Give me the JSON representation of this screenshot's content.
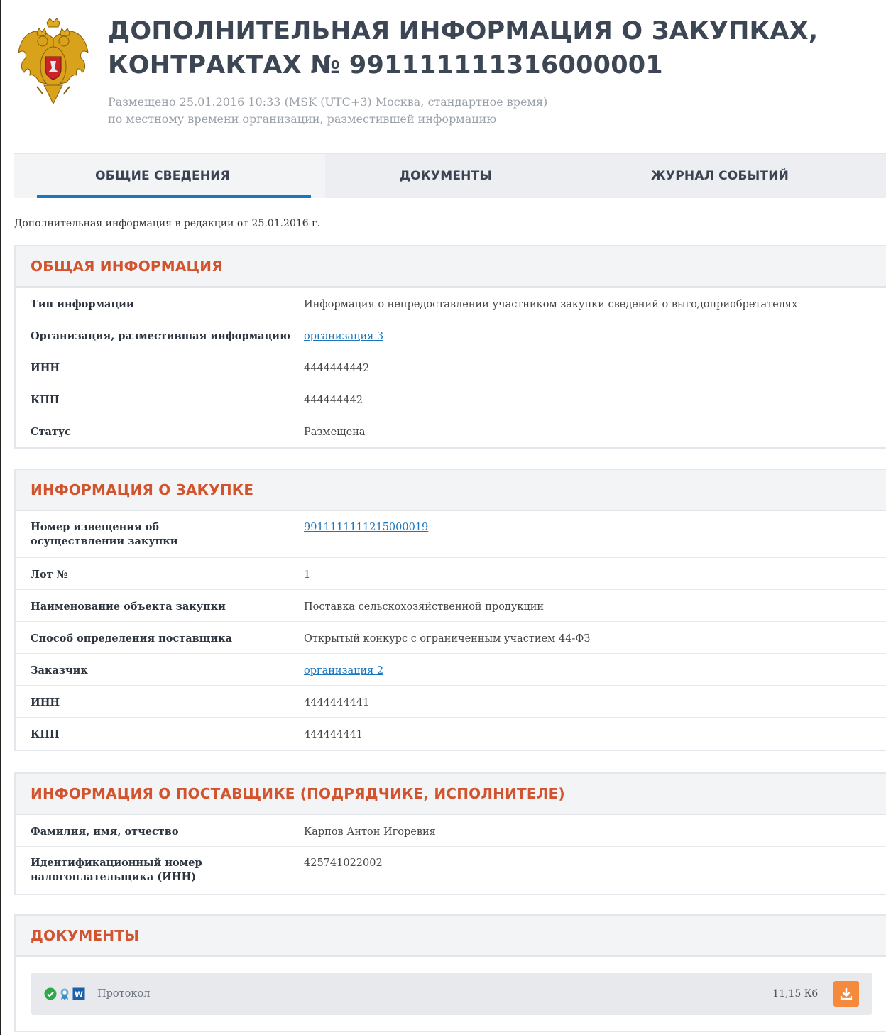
{
  "header": {
    "title": "ДОПОЛНИТЕЛЬНАЯ ИНФОРМАЦИЯ О ЗАКУПКАХ, КОНТРАКТАХ № 991111111316000001",
    "subtitle_line1": "Размещено 25.01.2016 10:33 (MSK (UTC+3) Москва, стандартное время)",
    "subtitle_line2": "по местному времени организации, разместившей информацию"
  },
  "tabs": [
    {
      "label": "ОБЩИЕ СВЕДЕНИЯ",
      "active": true
    },
    {
      "label": "ДОКУМЕНТЫ",
      "active": false
    },
    {
      "label": "ЖУРНАЛ СОБЫТИЙ",
      "active": false
    }
  ],
  "edition_text": "Дополнительная информация в редакции от 25.01.2016 г.",
  "general": {
    "title": "ОБЩАЯ ИНФОРМАЦИЯ",
    "rows": [
      {
        "label": "Тип информации",
        "value": "Информация о непредоставлении участником закупки сведений о выгодоприобретателях"
      },
      {
        "label": "Организация, разместившая информацию",
        "value": "организация 3"
      },
      {
        "label": "ИНН",
        "value": "4444444442"
      },
      {
        "label": "КПП",
        "value": "444444442"
      },
      {
        "label": "Статус",
        "value": "Размещена"
      }
    ]
  },
  "purchase": {
    "title": "ИНФОРМАЦИЯ О ЗАКУПКЕ",
    "rows": [
      {
        "label": "Номер извещения об осуществлении закупки",
        "value": "9911111111215000019"
      },
      {
        "label": "Лот №",
        "value": "1"
      },
      {
        "label": "Наименование объекта закупки",
        "value": "Поставка сельскохозяйственной продукции"
      },
      {
        "label": "Способ определения поставщика",
        "value": "Открытый конкурс с ограниченным участием 44-ФЗ"
      },
      {
        "label": "Заказчик",
        "value": "организация 2"
      },
      {
        "label": "ИНН",
        "value": "4444444441"
      },
      {
        "label": "КПП",
        "value": "444444441"
      }
    ]
  },
  "supplier": {
    "title": "ИНФОРМАЦИЯ О ПОСТАВЩИКЕ (ПОДРЯДЧИКЕ, ИСПОЛНИТЕЛЕ)",
    "rows": [
      {
        "label": "Фамилия, имя, отчество",
        "value": "Карпов Антон Игоревия"
      },
      {
        "label": "Идентификационный номер налогоплательщика (ИНН)",
        "value": "425741022002"
      }
    ]
  },
  "documents": {
    "title": "ДОКУМЕНТЫ",
    "items": [
      {
        "name": "Протокол",
        "size": "11,15 Кб",
        "icons": [
          "check-circle-icon",
          "certificate-icon",
          "word-file-icon"
        ]
      }
    ]
  },
  "colors": {
    "section_title": "#d2542e",
    "link": "#1a76bd",
    "download_button": "#f58a3d",
    "check": "#2ea84a"
  }
}
